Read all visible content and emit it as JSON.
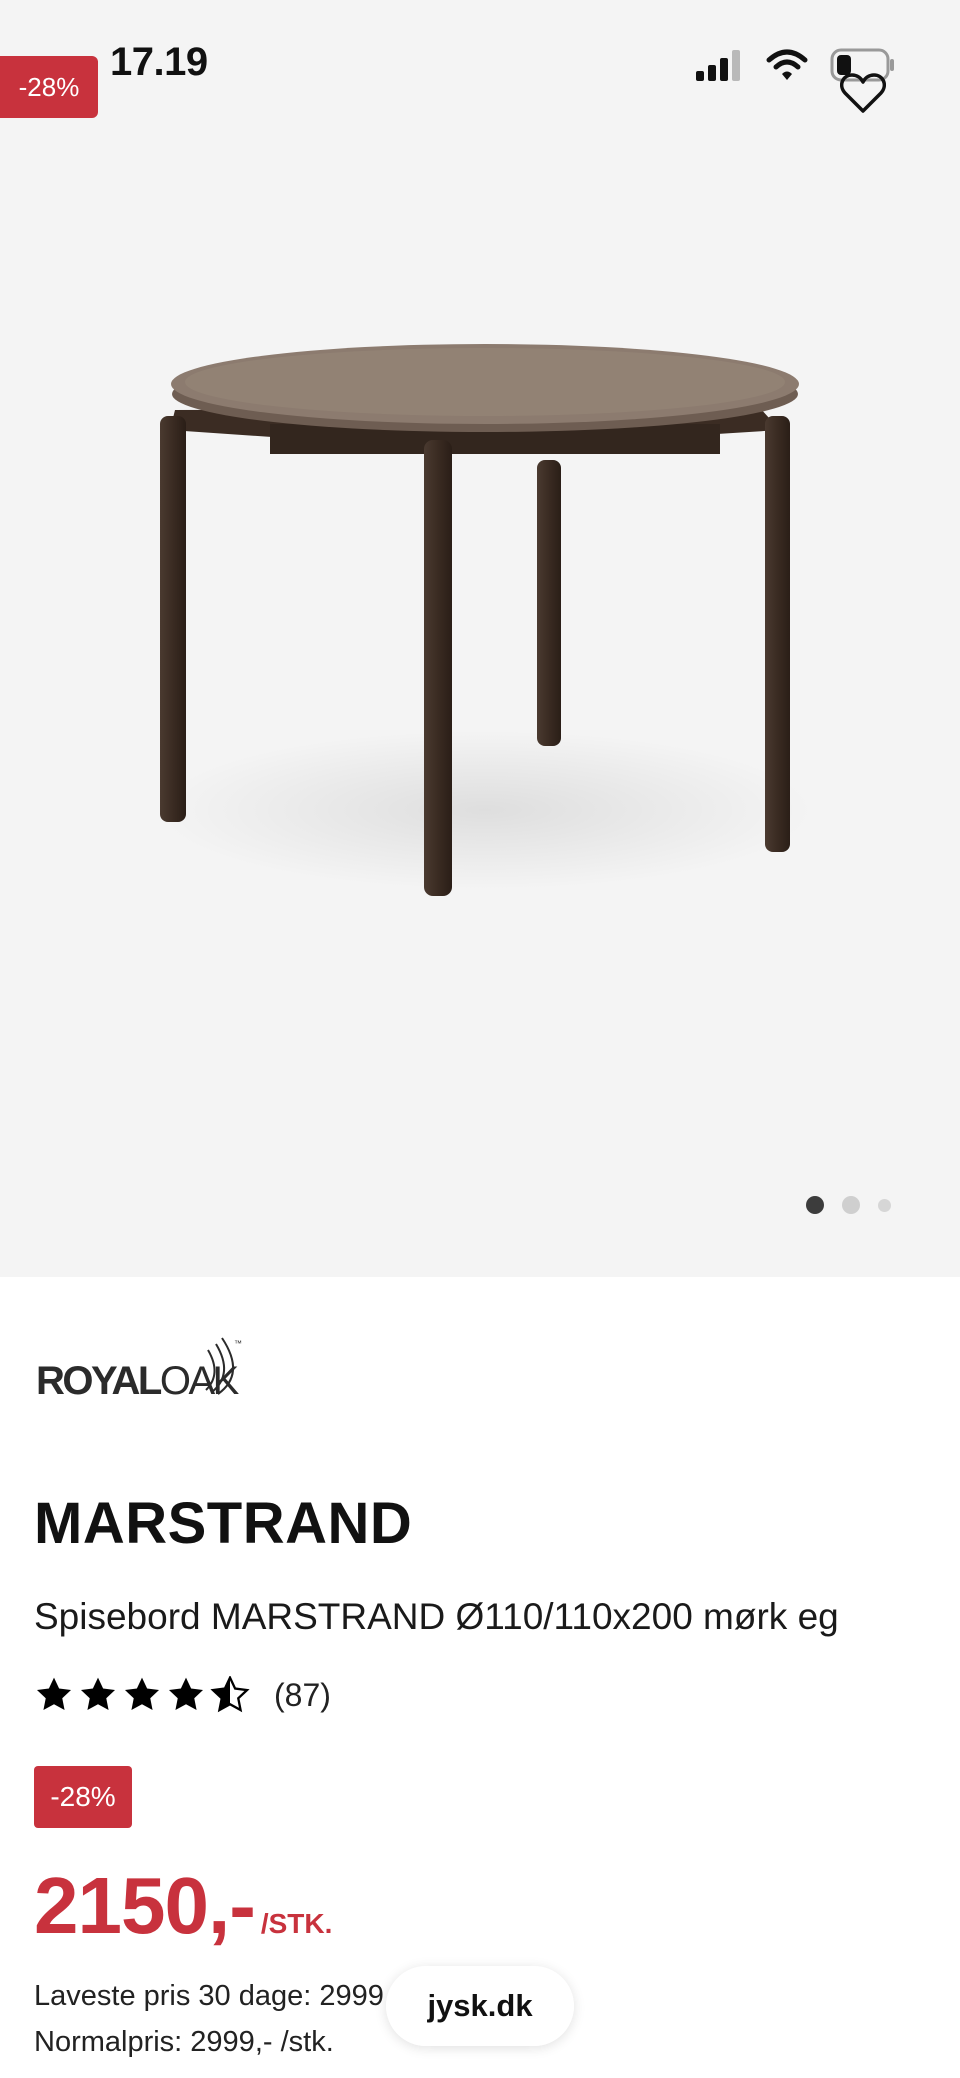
{
  "status_bar": {
    "time": "17.19"
  },
  "gallery": {
    "discount_tag": "-28%",
    "slide_count": 3,
    "active_slide": 1,
    "icons": [
      "heart-icon",
      "signal-icon",
      "wifi-icon",
      "battery-icon"
    ]
  },
  "brand": {
    "name": "ROYALOAK",
    "name_bold": "ROYAL",
    "name_light": "OAK",
    "trademark": "™"
  },
  "product": {
    "title": "MARSTRAND",
    "subtitle": "Spisebord MARSTRAND Ø110/110x200 mørk eg",
    "rating_value": 4.5,
    "rating_max": 5,
    "rating_count": "(87)",
    "discount_badge": "-28%",
    "price": "2150,-",
    "price_unit": "/STK.",
    "lowest_price": "Laveste pris 30 dage: 2999",
    "normal_price": "Normalpris: 2999,- /stk."
  },
  "browser": {
    "url": "jysk.dk"
  },
  "colors": {
    "accent": "#c8323d",
    "background_image": "#f4f4f4",
    "text": "#111111"
  }
}
